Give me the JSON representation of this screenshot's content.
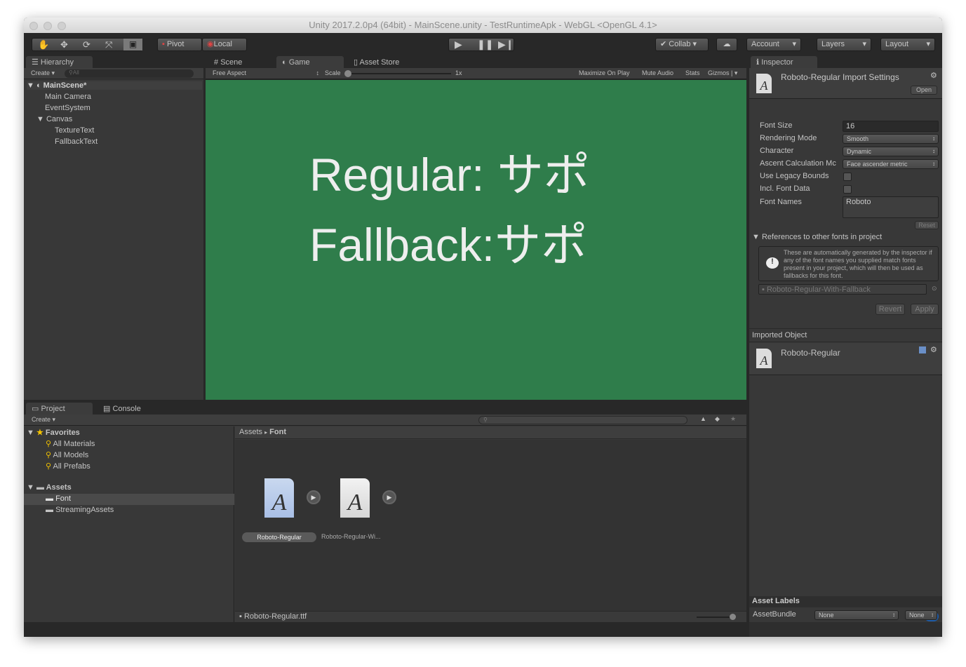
{
  "window": {
    "title": "Unity 2017.2.0p4 (64bit) - MainScene.unity - TestRuntimeApk - WebGL <OpenGL 4.1>"
  },
  "toolbar": {
    "pivot": "Pivot",
    "local": "Local",
    "collab": "Collab",
    "account": "Account",
    "layers": "Layers",
    "layout": "Layout"
  },
  "hierarchy": {
    "tab": "Hierarchy",
    "create": "Create",
    "search_placeholder": "All",
    "scene": "MainScene*",
    "items": [
      "Main Camera",
      "EventSystem",
      "Canvas",
      "TextureText",
      "FallbackText"
    ]
  },
  "game": {
    "tabs": [
      "Scene",
      "Game",
      "Asset Store"
    ],
    "aspect": "Free Aspect",
    "scale_label": "Scale",
    "scale_value": "1x",
    "options": [
      "Maximize On Play",
      "Mute Audio",
      "Stats",
      "Gizmos"
    ],
    "lines": [
      "Regular: サポ",
      "Fallback:サポ"
    ],
    "bg_color": "#2f7d4b"
  },
  "inspector": {
    "tab": "Inspector",
    "title": "Roboto-Regular Import Settings",
    "open": "Open",
    "props": [
      {
        "label": "Font Size",
        "value": "16"
      },
      {
        "label": "Rendering Mode",
        "value": "Smooth"
      },
      {
        "label": "Character",
        "value": "Dynamic"
      },
      {
        "label": "Ascent Calculation Mc",
        "value": "Face ascender metric"
      },
      {
        "label": "Use Legacy Bounds"
      },
      {
        "label": "Incl. Font Data"
      },
      {
        "label": "Font Names",
        "value": "Roboto"
      }
    ],
    "reset": "Reset",
    "references": "References to other fonts in project",
    "info": "These are automatically generated by the inspector if any of the font names you supplied match fonts present in your project, which will then be used as fallbacks for this font.",
    "fallback": "Roboto-Regular-With-Fallback",
    "revert": "Revert",
    "apply": "Apply",
    "imported_object": "Imported Object",
    "imported_name": "Roboto-Regular",
    "asset_labels": "Asset Labels",
    "assetbundle": "AssetBundle",
    "bundle_value": "None",
    "variant_value": "None"
  },
  "project": {
    "tabs": [
      "Project",
      "Console"
    ],
    "create": "Create",
    "favorites": "Favorites",
    "fav_items": [
      "All Materials",
      "All Models",
      "All Prefabs"
    ],
    "assets": "Assets",
    "folders": [
      "Font",
      "StreamingAssets"
    ],
    "breadcrumb": [
      "Assets",
      "Font"
    ],
    "files": [
      "Roboto-Regular",
      "Roboto-Regular-Wi..."
    ],
    "status_file": "Roboto-Regular.ttf"
  }
}
